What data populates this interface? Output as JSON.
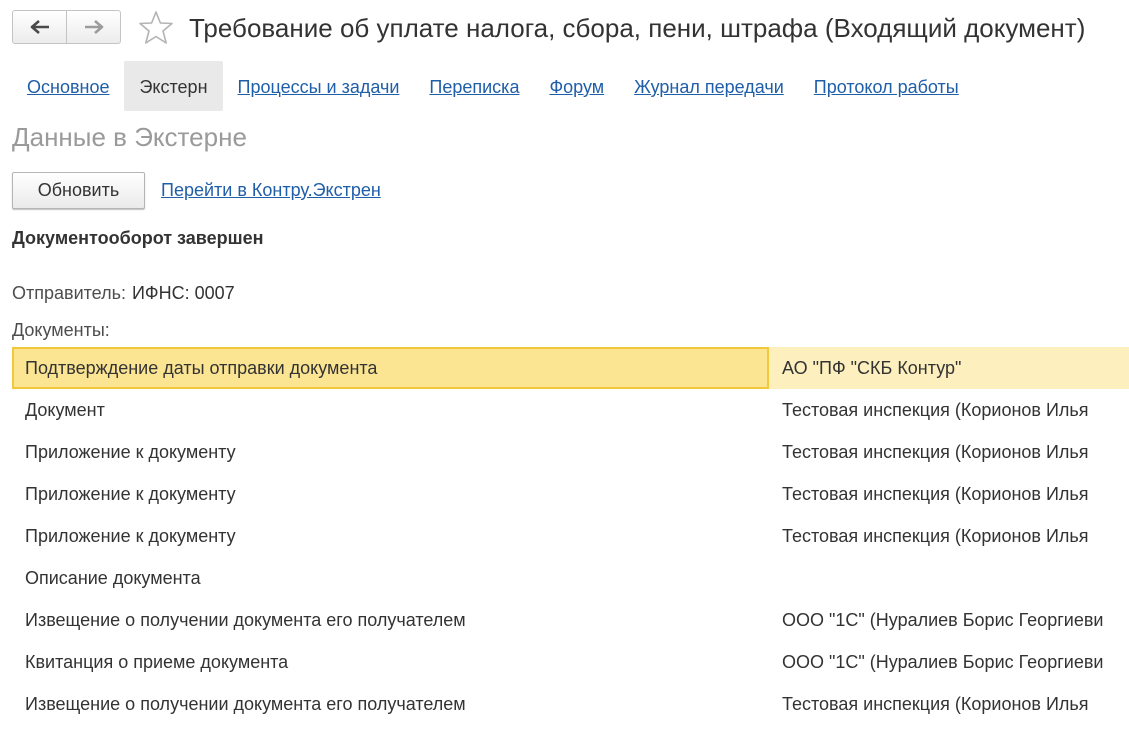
{
  "window": {
    "title": "Требование об уплате налога, сбора, пени, штрафа (Входящий документ)",
    "back_icon": "arrow-left-icon",
    "forward_icon": "arrow-right-icon",
    "favorite_icon": "star-icon"
  },
  "tabs": [
    {
      "label": "Основное",
      "active": false
    },
    {
      "label": "Экстерн",
      "active": true
    },
    {
      "label": "Процессы и задачи",
      "active": false
    },
    {
      "label": "Переписка",
      "active": false
    },
    {
      "label": "Форум",
      "active": false
    },
    {
      "label": "Журнал передачи",
      "active": false
    },
    {
      "label": "Протокол работы",
      "active": false
    }
  ],
  "section": {
    "title": "Данные в Экстерне",
    "refresh_label": "Обновить",
    "kontur_link": "Перейти в Контру.Экстрен",
    "status": "Документооборот завершен",
    "sender_label": "Отправитель:",
    "sender_value": "ИФНС: 0007",
    "documents_label": "Документы:"
  },
  "documents": [
    {
      "name": "Подтверждение даты отправки документа",
      "sender": "АО \"ПФ \"СКБ Контур\"",
      "selected": true
    },
    {
      "name": "Документ",
      "sender": "Тестовая инспекция (Корионов  Илья",
      "selected": false
    },
    {
      "name": "Приложение к документу",
      "sender": "Тестовая инспекция (Корионов  Илья",
      "selected": false
    },
    {
      "name": "Приложение к документу",
      "sender": "Тестовая инспекция (Корионов  Илья",
      "selected": false
    },
    {
      "name": "Приложение к документу",
      "sender": "Тестовая инспекция (Корионов  Илья",
      "selected": false
    },
    {
      "name": "Описание документа",
      "sender": "",
      "selected": false
    },
    {
      "name": "Извещение о получении документа его получателем",
      "sender": "ООО \"1С\" (Нуралиев Борис Георгиеви",
      "selected": false
    },
    {
      "name": "Квитанция о приеме документа",
      "sender": "ООО \"1С\" (Нуралиев Борис Георгиеви",
      "selected": false
    },
    {
      "name": "Извещение о получении документа его получателем",
      "sender": "Тестовая инспекция (Корионов  Илья",
      "selected": false
    }
  ],
  "colors": {
    "link": "#1f5ea8",
    "selection_fill": "#fbe593",
    "selection_border": "#f2c83b",
    "selection_row": "#fdf0be",
    "active_tab": "#e9e9e9"
  }
}
